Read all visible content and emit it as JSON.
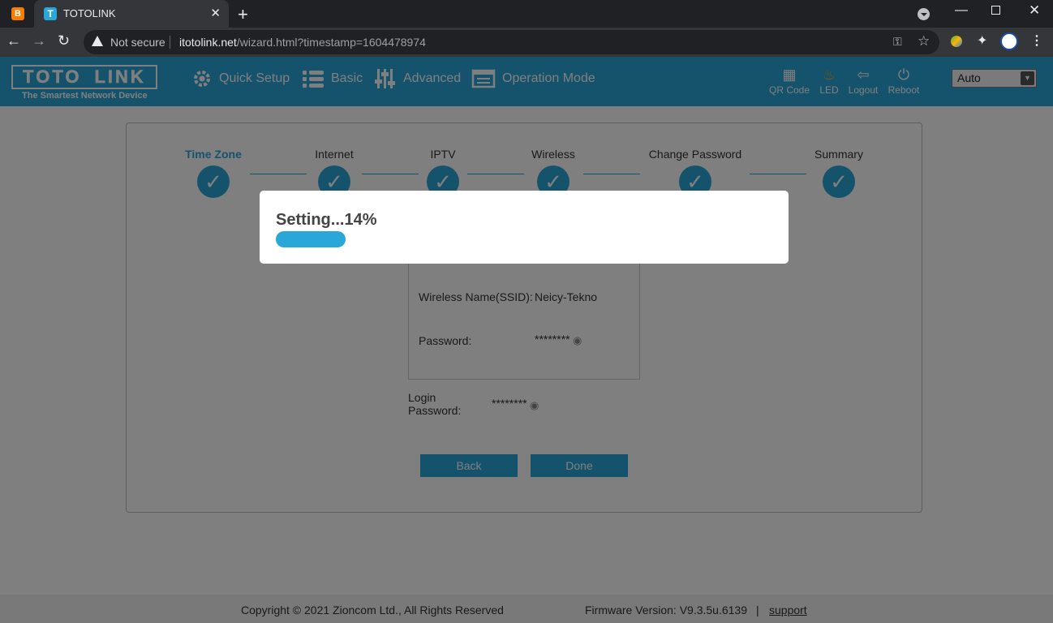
{
  "browser": {
    "tab_title": "TOTOLINK",
    "not_secure": "Not secure",
    "url_host": "itotolink.net",
    "url_path": "/wizard.html?timestamp=1604478974"
  },
  "header": {
    "logo_left": "TOTO",
    "logo_right": "LINK",
    "logo_tagline": "The Smartest Network Device",
    "nav": [
      "Quick Setup",
      "Basic",
      "Advanced",
      "Operation Mode"
    ],
    "icons": [
      "QR Code",
      "LED",
      "Logout",
      "Reboot"
    ],
    "language": "Auto"
  },
  "wizard": {
    "steps": [
      "Time Zone",
      "Internet",
      "IPTV",
      "Wireless",
      "Change Password",
      "Summary"
    ],
    "current_step": "Time Zone",
    "ssid_label": "Wireless Name(SSID):",
    "ssid_value": "Neicy-Tekno",
    "password_label": "Password:",
    "password_value": "********",
    "login_label": "Login Password:",
    "login_value": "********",
    "back_label": "Back",
    "done_label": "Done"
  },
  "footer": {
    "copyright": "Copyright © 2021 Zioncom Ltd., All Rights Reserved",
    "firmware": "Firmware Version: V9.3.5u.6139",
    "separator": "|",
    "support": "support"
  },
  "modal": {
    "title": "Setting...14%",
    "progress": 0.14
  },
  "colors": {
    "accent": "#2aa7d9"
  }
}
